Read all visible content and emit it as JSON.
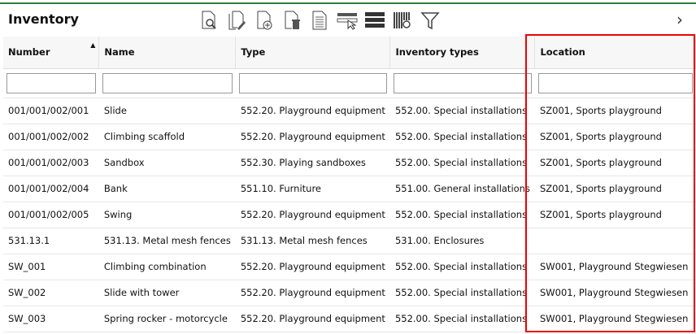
{
  "header": {
    "title": "Inventory",
    "toolbar": [
      "search-document-icon",
      "edit-document-icon",
      "add-document-icon",
      "delete-document-icon",
      "document-icon",
      "select-row-icon",
      "rows-icon",
      "column-settings-icon",
      "filter-icon"
    ],
    "next_label": "›"
  },
  "colors": {
    "accent": "#2e7d3e",
    "highlight": "#e00000"
  },
  "table": {
    "columns": [
      "Number",
      "Name",
      "Type",
      "Inventory types",
      "Location"
    ],
    "sort_column": "Number",
    "sort_direction": "ascending",
    "rows": [
      [
        "001/001/002/001",
        "Slide",
        "552.20. Playground equipment",
        "552.00. Special installations",
        "SZ001, Sports playground"
      ],
      [
        "001/001/002/002",
        "Climbing scaffold",
        "552.20. Playground equipment",
        "552.00. Special installations",
        "SZ001, Sports playground"
      ],
      [
        "001/001/002/003",
        "Sandbox",
        "552.30. Playing sandboxes",
        "552.00. Special installations",
        "SZ001, Sports playground"
      ],
      [
        "001/001/002/004",
        "Bank",
        "551.10. Furniture",
        "551.00. General installations",
        "SZ001, Sports playground"
      ],
      [
        "001/001/002/005",
        "Swing",
        "552.20. Playground equipment",
        "552.00. Special installations",
        "SZ001, Sports playground"
      ],
      [
        "531.13.1",
        "531.13. Metal mesh fences",
        "531.13. Metal mesh fences",
        "531.00. Enclosures",
        ""
      ],
      [
        "SW_001",
        "Climbing combination",
        "552.20. Playground equipment",
        "552.00. Special installations",
        "SW001, Playground Stegwiesen"
      ],
      [
        "SW_002",
        "Slide with tower",
        "552.20. Playground equipment",
        "552.00. Special installations",
        "SW001, Playground Stegwiesen"
      ],
      [
        "SW_003",
        "Spring rocker - motorcycle",
        "552.20. Playground equipment",
        "552.00. Special installations",
        "SW001, Playground Stegwiesen"
      ]
    ]
  }
}
